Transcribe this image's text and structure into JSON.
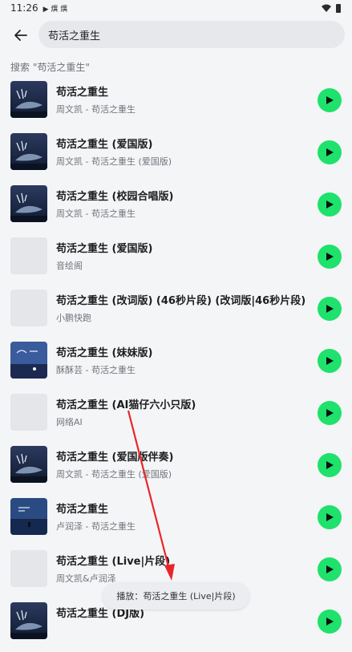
{
  "status_bar": {
    "time": "11:26",
    "notif_glyphs": "▶ 熼 熼"
  },
  "search": {
    "query": "苟活之重生",
    "hint": "搜索 \"苟活之重生\""
  },
  "songs": [
    {
      "title": "苟活之重生",
      "artist": "周文凯 - 苟活之重生",
      "cover": "whale"
    },
    {
      "title": "苟活之重生 (爱国版)",
      "artist": "周文凯 - 苟活之重生 (爱国版)",
      "cover": "whale"
    },
    {
      "title": "苟活之重生 (校园合唱版)",
      "artist": "周文凯 - 苟活之重生",
      "cover": "whale"
    },
    {
      "title": "苟活之重生 (爱国版)",
      "artist": "音绘阁",
      "cover": "blank"
    },
    {
      "title": "苟活之重生 (改词版) (46秒片段) (改词版|46秒片段)",
      "artist": "小鹏快跑",
      "cover": "blank"
    },
    {
      "title": "苟活之重生 (妹妹版)",
      "artist": "酥酥芸 - 苟活之重生",
      "cover": "night"
    },
    {
      "title": "苟活之重生 (AI猫仔六小只版)",
      "artist": "网络AI",
      "cover": "blank"
    },
    {
      "title": "苟活之重生 (爱国版伴奏)",
      "artist": "周文凯 - 苟活之重生 (爱国版)",
      "cover": "whale"
    },
    {
      "title": "苟活之重生",
      "artist": "卢润泽 - 苟活之重生",
      "cover": "sea"
    },
    {
      "title": "苟活之重生 (Live|片段)",
      "artist": "周文凯&卢润泽",
      "cover": "blank"
    },
    {
      "title": "苟活之重生 (DJ版)",
      "artist": "",
      "cover": "whale"
    }
  ],
  "toast": {
    "text": "播放：苟活之重生 (Live|片段)"
  },
  "colors": {
    "accent": "#1ee26b",
    "annotation_arrow": "#e8262a",
    "background": "#f4f5f7"
  }
}
